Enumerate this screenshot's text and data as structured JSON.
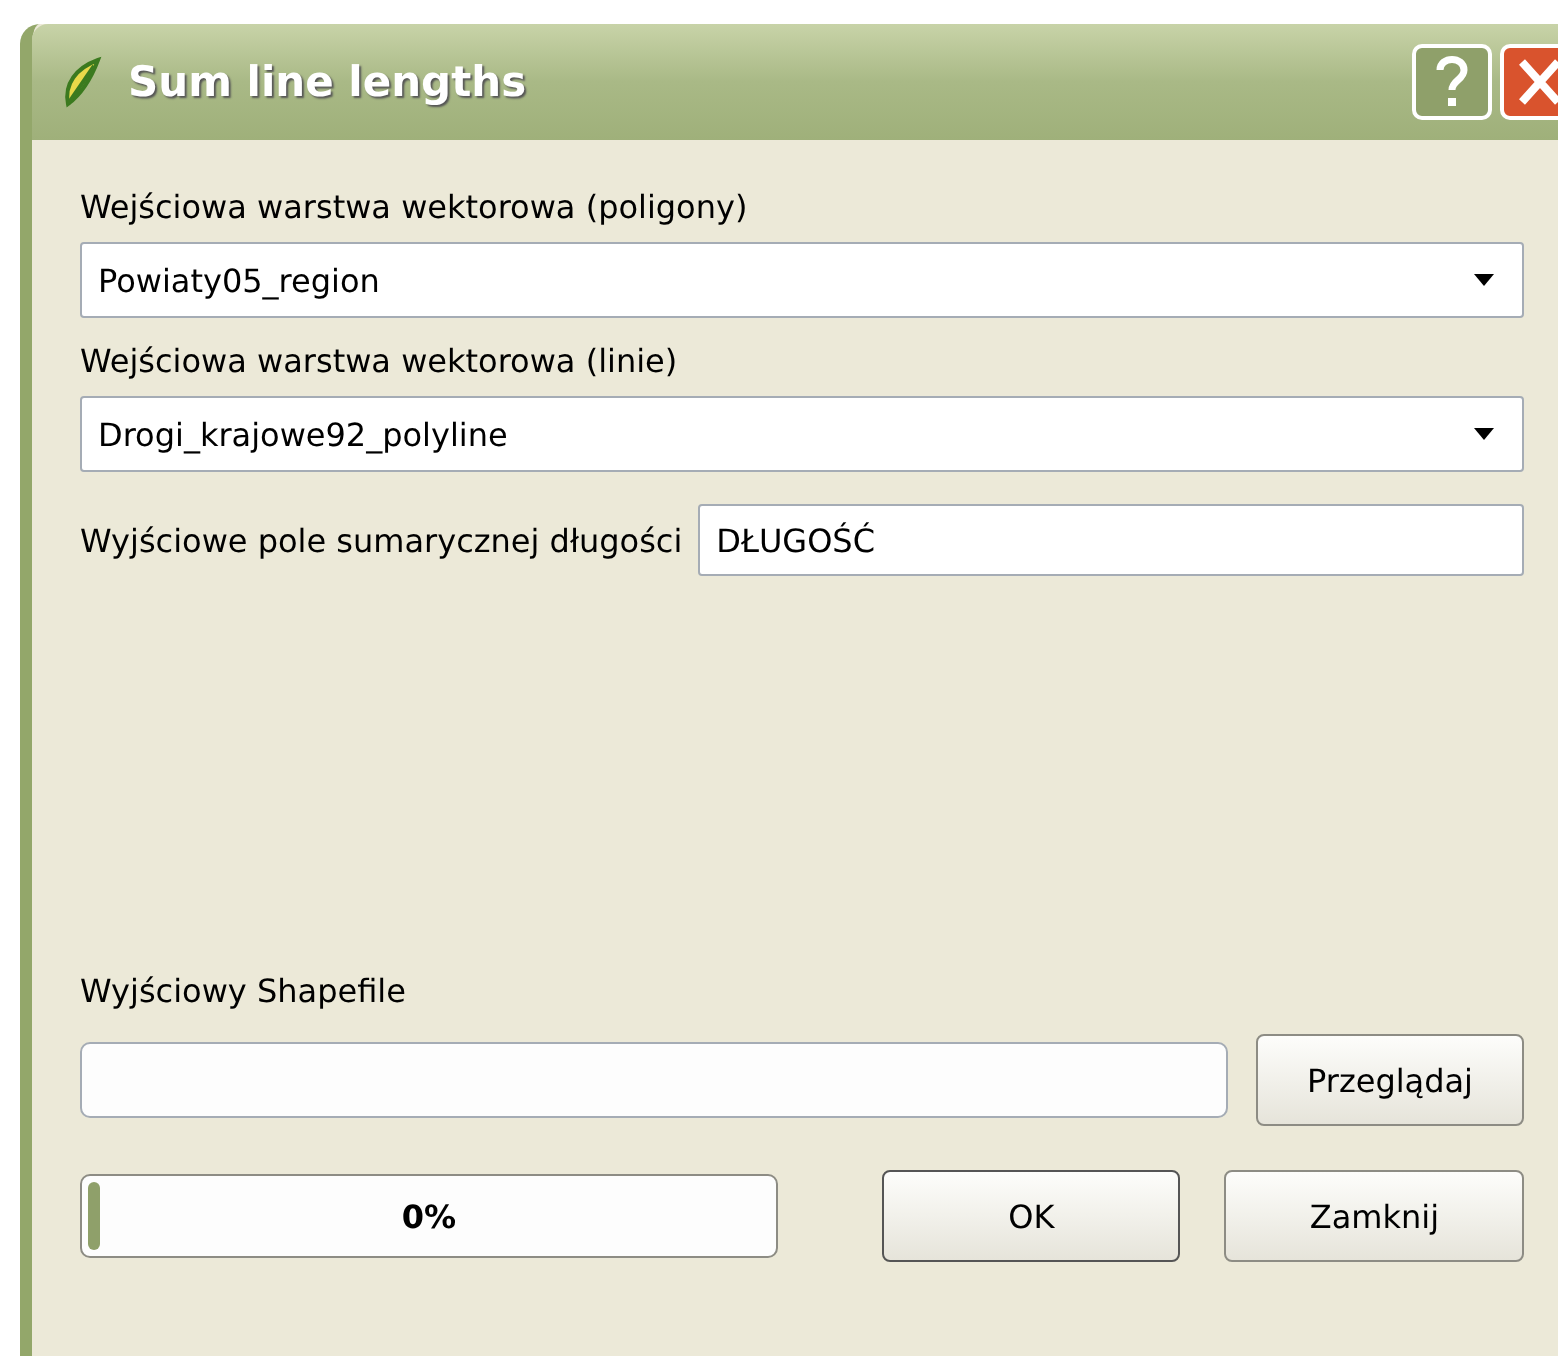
{
  "window": {
    "title": "Sum line lengths"
  },
  "polygon_layer": {
    "label": "Wejściowa warstwa wektorowa (poligony)",
    "value": "Powiaty05_region"
  },
  "line_layer": {
    "label": "Wejściowa warstwa wektorowa (linie)",
    "value": "Drogi_krajowe92_polyline"
  },
  "length_field": {
    "label": "Wyjściowe pole sumarycznej długości",
    "value": "DŁUGOŚĆ"
  },
  "output": {
    "label": "Wyjściowy Shapefile",
    "browse_button": "Przeglądaj"
  },
  "progress": {
    "level": 0,
    "reading": "0%"
  },
  "buttons": [
    "OK",
    "Zamknij"
  ]
}
